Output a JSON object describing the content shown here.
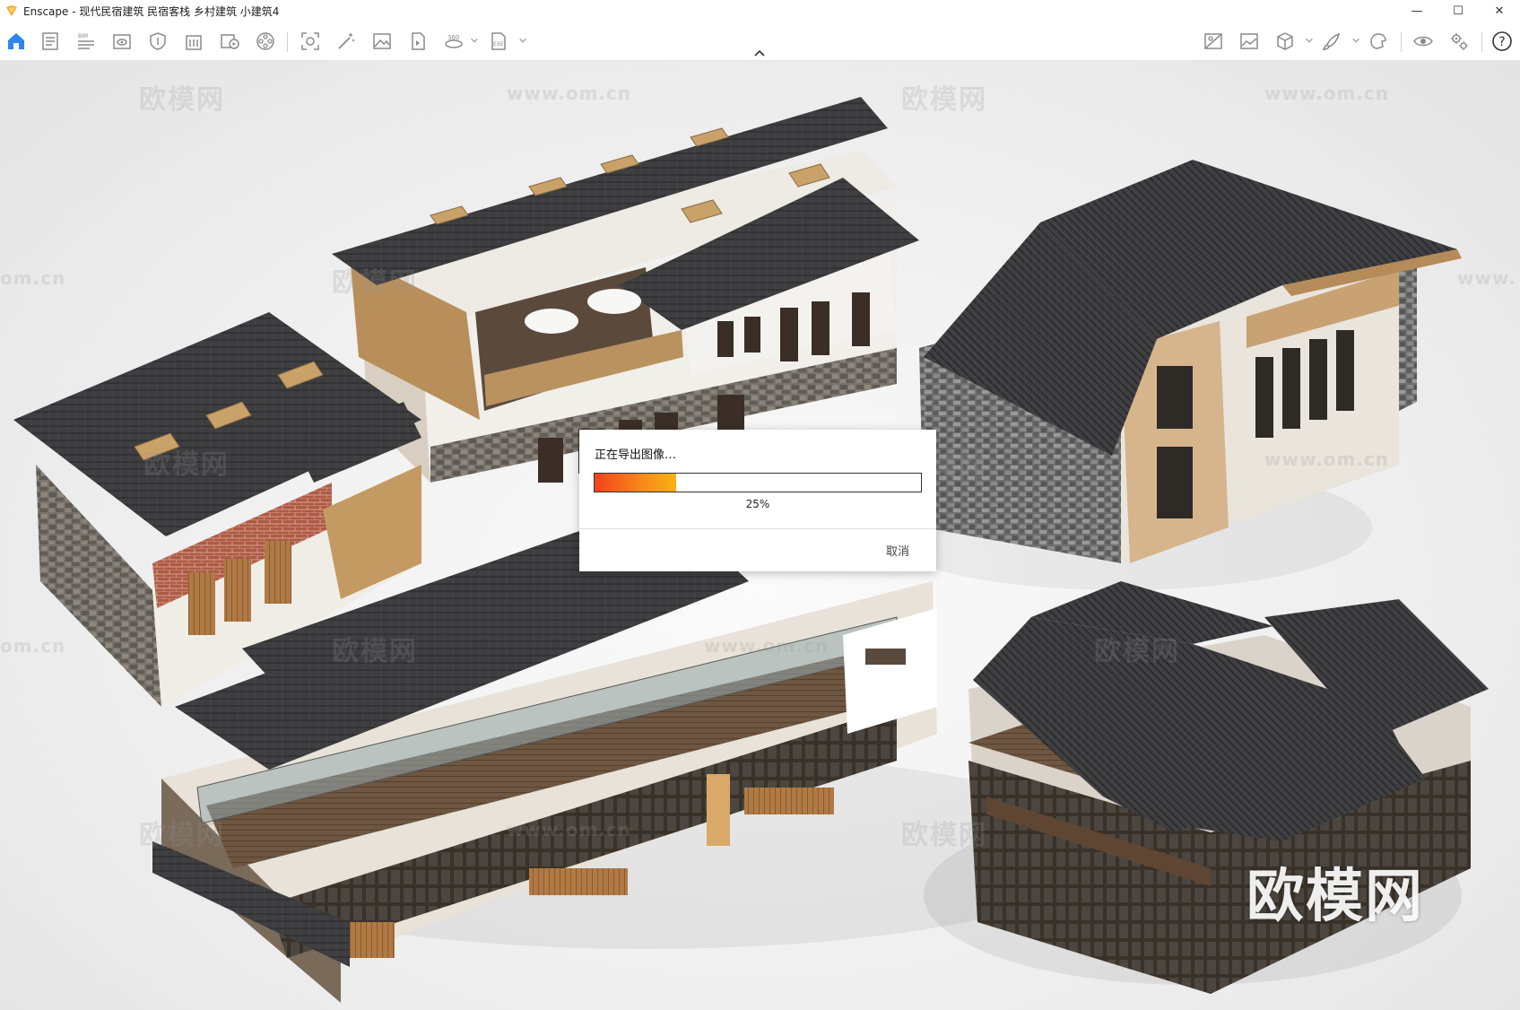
{
  "window": {
    "title": "Enscape - 现代民宿建筑 民宿客栈 乡村建筑 小建筑4",
    "minimize_glyph": "—",
    "maximize_glyph": "☐",
    "close_glyph": "✕"
  },
  "toolbar": {
    "left_icons": [
      "home-icon",
      "document-icon",
      "bim-icon",
      "view-icon",
      "shield-icon",
      "building-icon",
      "video-editor-icon",
      "film-reel-icon",
      "screenshot-icon",
      "magic-wand-icon",
      "image-icon",
      "batch-render-icon",
      "panorama-360-icon",
      "exe-export-icon"
    ],
    "right_icons": [
      "visual-settings-icon",
      "atmosphere-icon",
      "cube-icon",
      "brush-icon",
      "material-icon",
      "eye-icon",
      "settings-icon",
      "help-icon"
    ],
    "bim_label": "BIM",
    "pano_label": "360",
    "exe_label": "EXE",
    "help_glyph": "?",
    "accent": "#2e86f0"
  },
  "watermarks": {
    "brand": "欧模网",
    "url": "www.om.cn",
    "url_short": "om.cn",
    "url_prefix": "www."
  },
  "dialog": {
    "title": "正在导出图像…",
    "progress": 0.25,
    "percent_label": "25%",
    "cancel_label": "取消"
  }
}
